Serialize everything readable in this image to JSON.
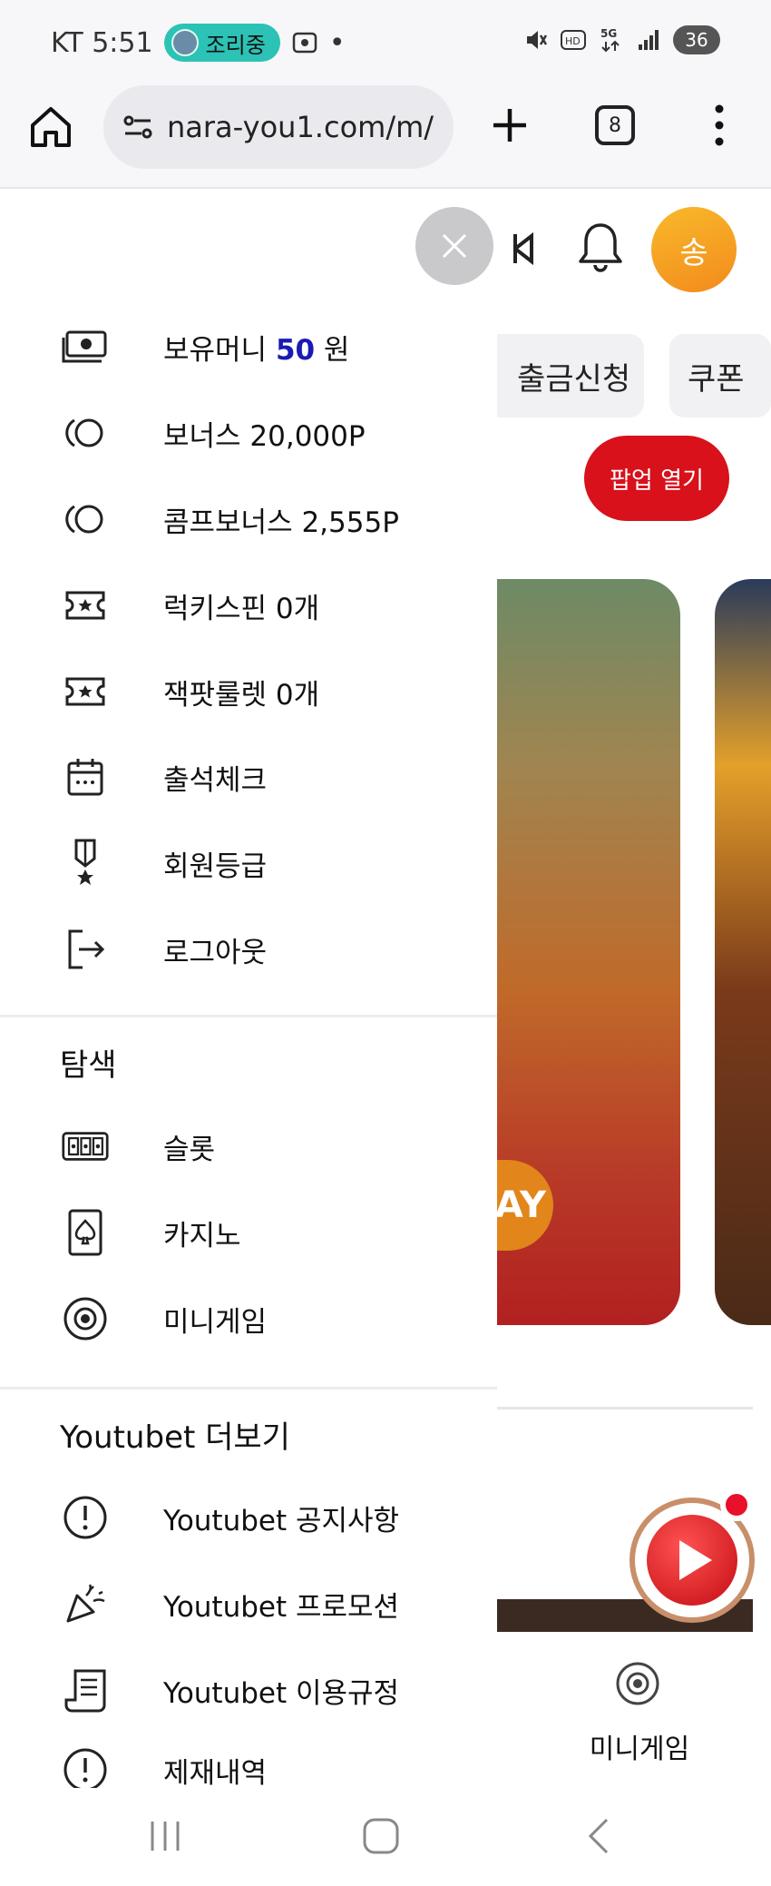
{
  "status_bar": {
    "carrier_time": "KT 5:51",
    "pill_label": "조리중",
    "dot": "•",
    "battery": "36",
    "icons": [
      "screenshot-icon",
      "mute-icon",
      "hd-icon",
      "5g-icon",
      "signal-icon",
      "battery-icon"
    ]
  },
  "browser": {
    "url": "nara-you1.com/m/",
    "tab_count": "8"
  },
  "background": {
    "avatar": "송",
    "tabs": [
      "출금신청",
      "쿠폰"
    ],
    "popup_button": "팝업 열기",
    "banner_text": "AY",
    "mini_game_label": "미니게임"
  },
  "drawer": {
    "account_items": [
      {
        "icon": "money-icon",
        "prefix": "보유머니 ",
        "amount": "50",
        "suffix": " 원"
      },
      {
        "icon": "coin-icon",
        "label": "보너스 20,000P"
      },
      {
        "icon": "coin-icon",
        "label": "콤프보너스 2,555P"
      },
      {
        "icon": "ticket-icon",
        "label": "럭키스핀 0개"
      },
      {
        "icon": "ticket-icon",
        "label": "잭팟룰렛 0개"
      },
      {
        "icon": "calendar-icon",
        "label": "출석체크"
      },
      {
        "icon": "medal-icon",
        "label": "회원등급"
      },
      {
        "icon": "logout-icon",
        "label": "로그아웃"
      }
    ],
    "explore_title": "탐색",
    "explore_items": [
      {
        "icon": "slot-icon",
        "label": "슬롯"
      },
      {
        "icon": "card-icon",
        "label": "카지노"
      },
      {
        "icon": "chip-icon",
        "label": "미니게임"
      }
    ],
    "more_title": "Youtubet 더보기",
    "more_items": [
      {
        "icon": "notice-icon",
        "label": "Youtubet 공지사항"
      },
      {
        "icon": "party-popper-icon",
        "label": "Youtubet 프로모션"
      },
      {
        "icon": "document-icon",
        "label": "Youtubet 이용규정"
      },
      {
        "icon": "notice-icon",
        "label": "제재내역"
      }
    ]
  },
  "colors": {
    "accent_red": "#d8111a",
    "amount_blue": "#1a1ab4",
    "avatar_orange": "#f5a623",
    "pill_teal": "#2cc2b5"
  }
}
